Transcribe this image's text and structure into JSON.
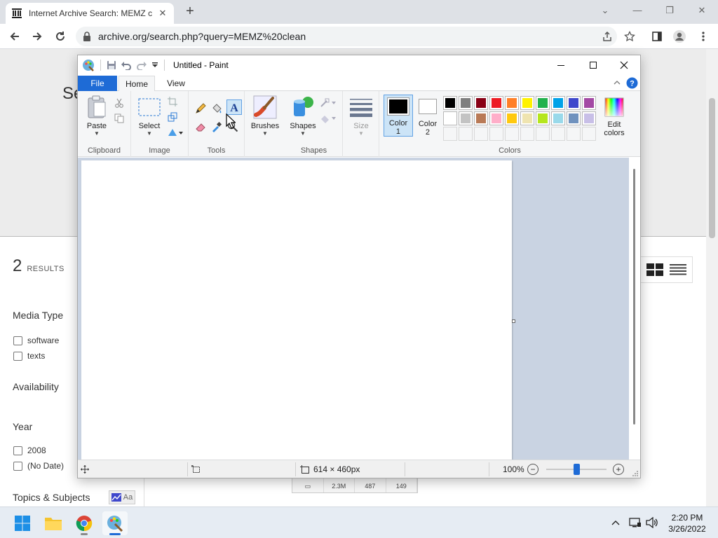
{
  "browser": {
    "tab_title": "Internet Archive Search: MEMZ c",
    "url": "archive.org/search.php?query=MEMZ%20clean"
  },
  "background_page": {
    "hero_text": "Se",
    "results_count": "2",
    "results_label": "RESULTS",
    "facets": [
      {
        "heading": "Media Type",
        "options": [
          "software",
          "texts"
        ]
      },
      {
        "heading": "Availability",
        "options": []
      },
      {
        "heading": "Year",
        "options": [
          "2008",
          "(No Date)"
        ]
      }
    ],
    "topics_heading": "Topics & Subjects",
    "topics_icon_label": "Aa",
    "stats": [
      "2.3M",
      "487",
      "149"
    ]
  },
  "paint": {
    "title": "Untitled - Paint",
    "tabs": {
      "file": "File",
      "home": "Home",
      "view": "View"
    },
    "groups": {
      "clipboard": "Clipboard",
      "image": "Image",
      "tools": "Tools",
      "shapes": "Shapes",
      "colors": "Colors"
    },
    "buttons": {
      "paste": "Paste",
      "select": "Select",
      "brushes": "Brushes",
      "shapes": "Shapes",
      "size": "Size",
      "color1": "Color\n1",
      "color2": "Color\n2",
      "edit_colors": "Edit\ncolors"
    },
    "color1_value": "#000000",
    "color2_value": "#ffffff",
    "palette": [
      "#000000",
      "#7f7f7f",
      "#880015",
      "#ed1c24",
      "#ff7f27",
      "#fff200",
      "#22b14c",
      "#00a2e8",
      "#3f48cc",
      "#a349a4",
      "#ffffff",
      "#c3c3c3",
      "#b97a57",
      "#ffaec9",
      "#ffc90e",
      "#efe4b0",
      "#b5e61d",
      "#99d9ea",
      "#7092be",
      "#c8bfe7"
    ],
    "status": {
      "canvas_size": "614 × 460px",
      "zoom": "100%",
      "zoom_fraction": 0.5
    }
  },
  "taskbar": {
    "time": "2:20 PM",
    "date": "3/26/2022"
  }
}
